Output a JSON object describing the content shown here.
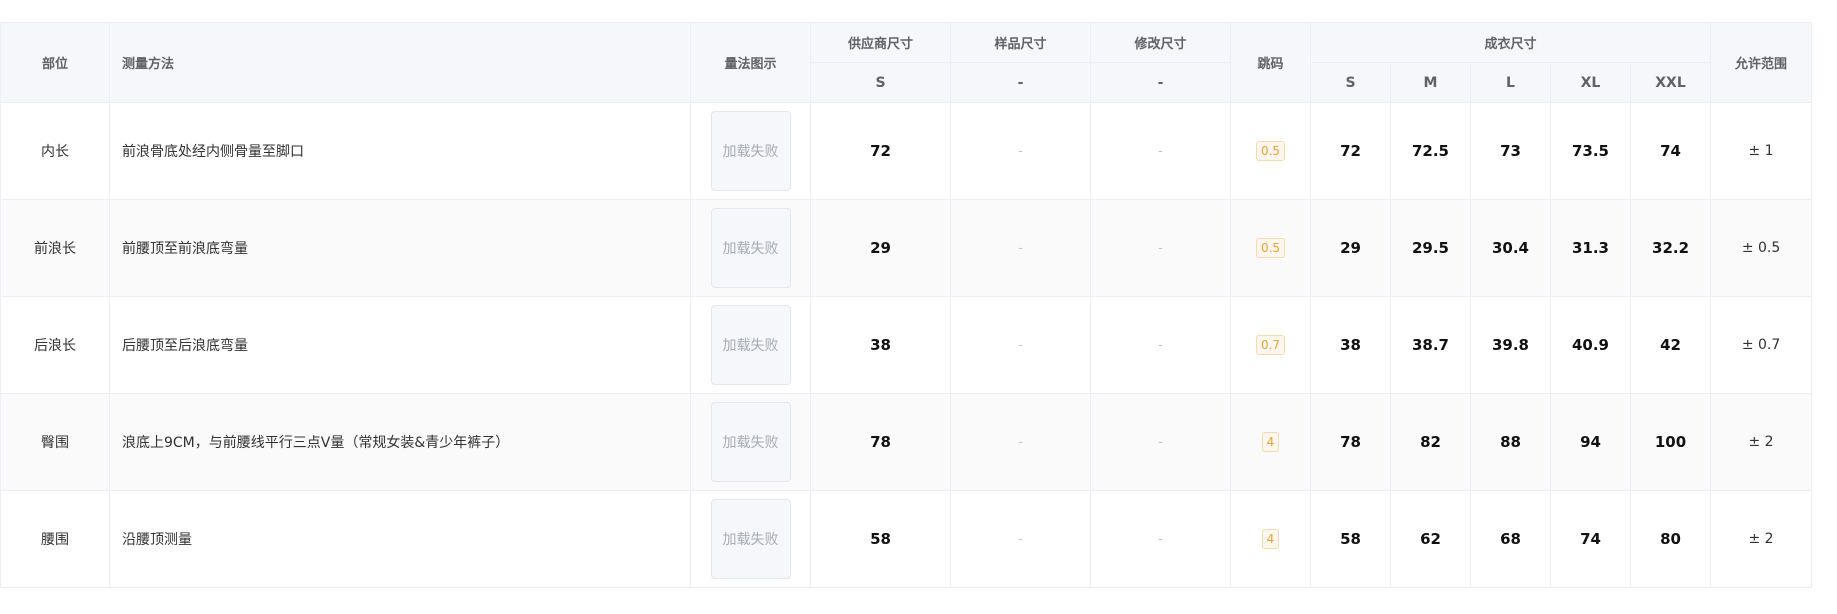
{
  "headers": {
    "part": "部位",
    "method": "测量方法",
    "image": "量法图示",
    "supplier": "供应商尺寸",
    "sample": "样品尺寸",
    "modified": "修改尺寸",
    "jump": "跳码",
    "garment": "成衣尺寸",
    "tolerance": "允许范围",
    "supplier_size": "S",
    "sample_sub": "-",
    "modified_sub": "-",
    "sizes": [
      "S",
      "M",
      "L",
      "XL",
      "XXL"
    ]
  },
  "rows": [
    {
      "part": "内长",
      "method": "前浪骨底处经内侧骨量至脚口",
      "image_text": "加载失败",
      "supplier": "72",
      "sample": "-",
      "modified": "-",
      "jump": "0.5",
      "sizes": [
        "72",
        "72.5",
        "73",
        "73.5",
        "74"
      ],
      "tolerance": "± 1"
    },
    {
      "part": "前浪长",
      "method": "前腰顶至前浪底弯量",
      "image_text": "加载失败",
      "supplier": "29",
      "sample": "-",
      "modified": "-",
      "jump": "0.5",
      "sizes": [
        "29",
        "29.5",
        "30.4",
        "31.3",
        "32.2"
      ],
      "tolerance": "± 0.5"
    },
    {
      "part": "后浪长",
      "method": "后腰顶至后浪底弯量",
      "image_text": "加载失败",
      "supplier": "38",
      "sample": "-",
      "modified": "-",
      "jump": "0.7",
      "sizes": [
        "38",
        "38.7",
        "39.8",
        "40.9",
        "42"
      ],
      "tolerance": "± 0.7"
    },
    {
      "part": "臀围",
      "method": "浪底上9CM，与前腰线平行三点V量（常规女装&青少年裤子）",
      "image_text": "加载失败",
      "supplier": "78",
      "sample": "-",
      "modified": "-",
      "jump": "4",
      "sizes": [
        "78",
        "82",
        "88",
        "94",
        "100"
      ],
      "tolerance": "± 2"
    },
    {
      "part": "腰围",
      "method": "沿腰顶测量",
      "image_text": "加载失败",
      "supplier": "58",
      "sample": "-",
      "modified": "-",
      "jump": "4",
      "sizes": [
        "58",
        "62",
        "68",
        "74",
        "80"
      ],
      "tolerance": "± 2"
    }
  ],
  "colors": {
    "header_bg": "#f5f7fa",
    "border": "#ebeef5",
    "jump_text": "#e6a23c",
    "jump_bg": "#fdf6ec"
  }
}
